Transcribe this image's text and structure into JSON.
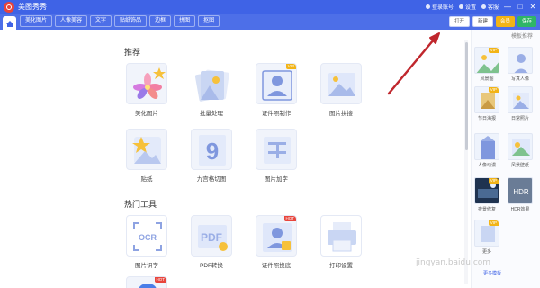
{
  "window": {
    "title": "美图秀秀",
    "logo_icon": "meitu-logo-icon",
    "right_items": [
      "登录账号",
      "设置",
      "客服"
    ],
    "controls": [
      "—",
      "□",
      "✕"
    ]
  },
  "tabbar": {
    "home_icon": "home-icon",
    "tabs": [
      "美化图片",
      "人像美容",
      "文字",
      "贴纸饰品",
      "边框",
      "拼图",
      "抠图"
    ],
    "actions": {
      "open": "打开",
      "new": "新建",
      "vip": "会员",
      "save": "保存"
    }
  },
  "sections": [
    {
      "title": "推荐",
      "items": [
        {
          "label": "美化图片",
          "icon": "flower-icon",
          "badge": ""
        },
        {
          "label": "批量处理",
          "icon": "batch-photos-icon",
          "badge": ""
        },
        {
          "label": "证件照制作",
          "icon": "id-photo-icon",
          "badge": "VIP"
        },
        {
          "label": "图片拼接",
          "icon": "image-stitch-icon",
          "badge": ""
        },
        {
          "label": "贴纸",
          "icon": "sticker-star-icon",
          "badge": ""
        },
        {
          "label": "九宫格切图",
          "icon": "nine-grid-icon",
          "badge": ""
        },
        {
          "label": "图片加字",
          "icon": "text-image-icon",
          "badge": ""
        }
      ]
    },
    {
      "title": "热门工具",
      "items": [
        {
          "label": "图片识字",
          "icon": "ocr-icon",
          "badge": ""
        },
        {
          "label": "PDF转换",
          "icon": "pdf-icon",
          "badge": ""
        },
        {
          "label": "证件照换底",
          "icon": "id-photo-bg-icon",
          "badge": "HOT"
        },
        {
          "label": "打印设置",
          "icon": "printer-icon",
          "badge": ""
        }
      ]
    }
  ],
  "side_panel": {
    "title": "模板推荐",
    "items": [
      {
        "label": "风景图",
        "badge": "VIP"
      },
      {
        "label": "写真人像",
        "badge": ""
      },
      {
        "label": "节日海报",
        "badge": "VIP"
      },
      {
        "label": "日常照片",
        "badge": ""
      },
      {
        "label": "人像动漫",
        "badge": ""
      },
      {
        "label": "风景壁纸",
        "badge": ""
      },
      {
        "label": "夜景修复",
        "badge": "VIP"
      },
      {
        "label": "HDR效果",
        "badge": ""
      },
      {
        "label": "更多",
        "badge": "VIP"
      }
    ],
    "footer": "更多模板"
  },
  "watermark": "jingyan.baidu.com",
  "colors": {
    "brand": "#3f63e6",
    "tab_bar": "#4d6fe8",
    "vip": "#f2b417",
    "save": "#2fb567",
    "hot": "#e8453c",
    "annotation": "#c0272d"
  }
}
